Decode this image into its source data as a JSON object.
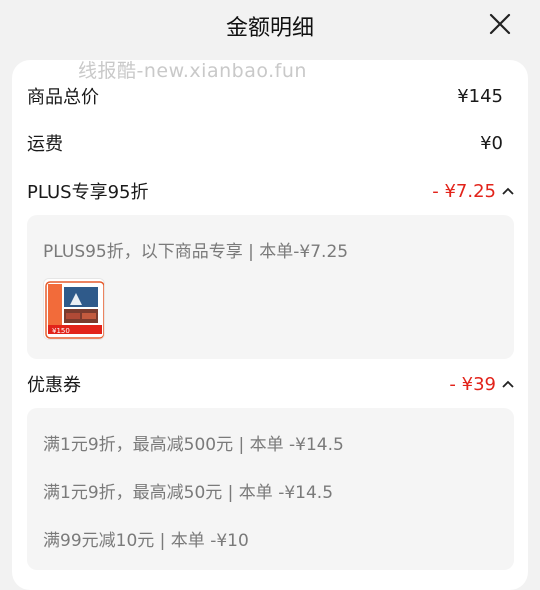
{
  "header": {
    "title": "金额明细"
  },
  "watermark": "线报酷-new.xianbao.fun",
  "summary": {
    "goods_total_label": "商品总价",
    "goods_total_value": "¥145",
    "shipping_label": "运费",
    "shipping_value": "¥0",
    "plus_label": "PLUS专享95折",
    "plus_value": "- ¥7.25",
    "coupon_label": "优惠券",
    "coupon_value": "- ¥39"
  },
  "plus_panel": {
    "text": "PLUS95折，以下商品专享 | 本单-¥7.25",
    "thumb_price": "¥150"
  },
  "coupon_panel": {
    "items": [
      "满1元9折，最高减500元 | 本单 -¥14.5",
      "满1元9折，最高减50元 | 本单 -¥14.5",
      "满99元减10元 | 本单 -¥10"
    ]
  },
  "colors": {
    "accent": "#e2231a",
    "panel_bg": "#f5f5f5",
    "page_bg": "#f2f2f2"
  },
  "icons": {
    "close": "close-icon",
    "collapse": "chevron-up-icon"
  }
}
